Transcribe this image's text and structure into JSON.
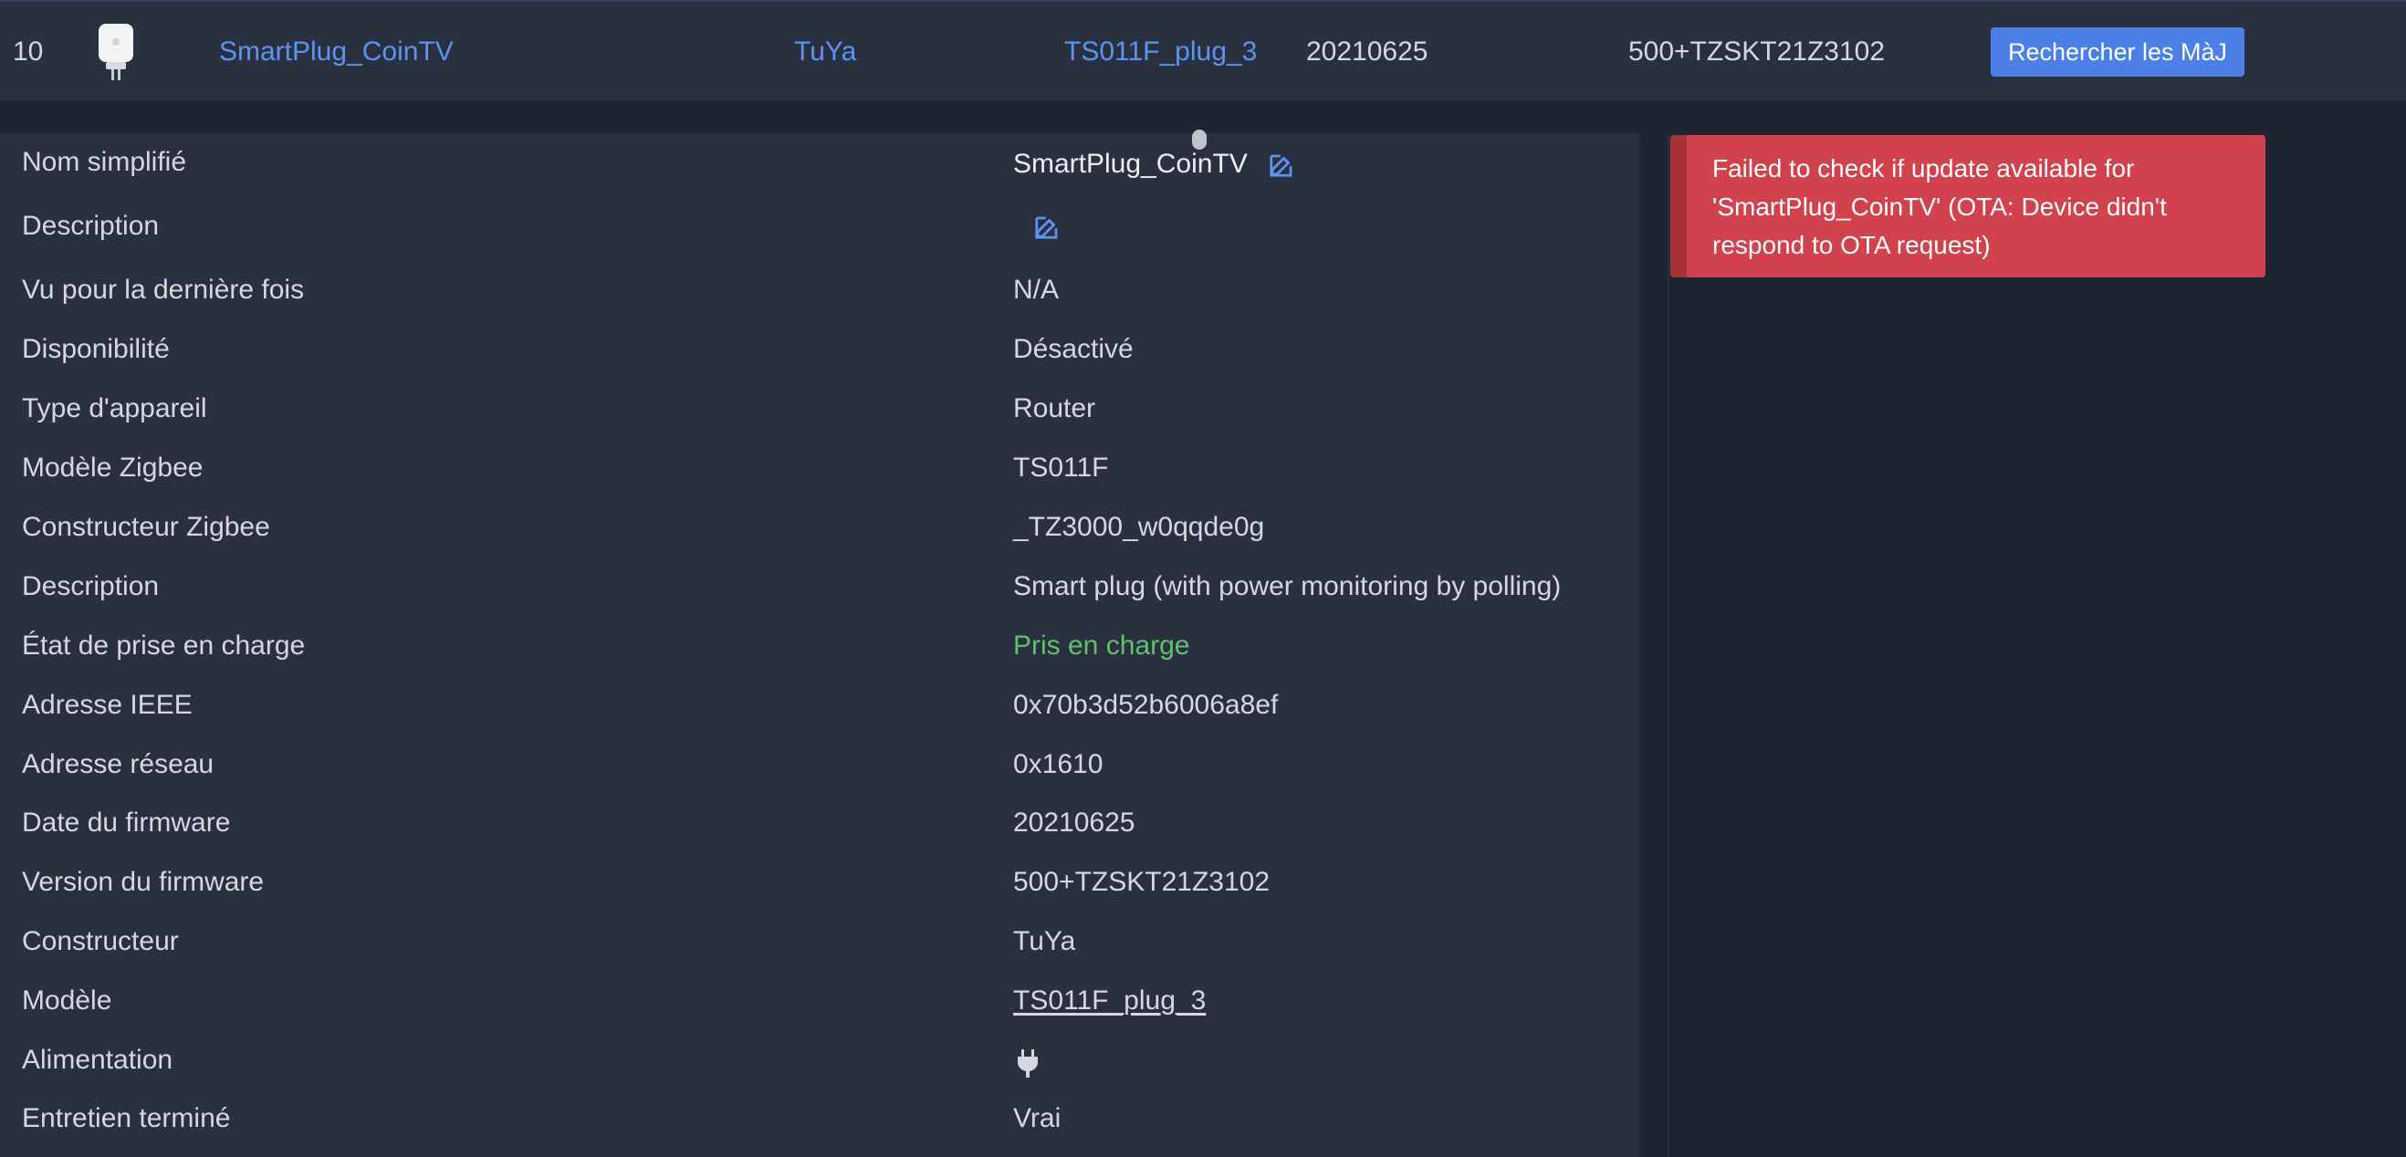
{
  "device_row": {
    "index": "10",
    "friendly_name": "SmartPlug_CoinTV",
    "vendor": "TuYa",
    "model": "TS011F_plug_3",
    "firmware_date": "20210625",
    "firmware_version": "500+TZSKT21Z3102",
    "check_update_label": "Rechercher les MàJ"
  },
  "details": [
    {
      "label": "Nom simplifié",
      "value": "SmartPlug_CoinTV"
    },
    {
      "label": "Description",
      "value": ""
    },
    {
      "label": "Vu pour la dernière fois",
      "value": "N/A"
    },
    {
      "label": "Disponibilité",
      "value": "Désactivé"
    },
    {
      "label": "Type d'appareil",
      "value": "Router"
    },
    {
      "label": "Modèle Zigbee",
      "value": "TS011F"
    },
    {
      "label": "Constructeur Zigbee",
      "value": "_TZ3000_w0qqde0g"
    },
    {
      "label": "Description",
      "value": "Smart plug (with power monitoring by polling)"
    },
    {
      "label": "État de prise en charge",
      "value": "Pris en charge"
    },
    {
      "label": "Adresse IEEE",
      "value": "0x70b3d52b6006a8ef"
    },
    {
      "label": "Adresse réseau",
      "value": "0x1610"
    },
    {
      "label": "Date du firmware",
      "value": "20210625"
    },
    {
      "label": "Version du firmware",
      "value": "500+TZSKT21Z3102"
    },
    {
      "label": "Constructeur",
      "value": "TuYa"
    },
    {
      "label": "Modèle",
      "value": "TS011F_plug_3"
    },
    {
      "label": "Alimentation",
      "value": "",
      "icon": "plug-icon"
    },
    {
      "label": "Entretien terminé",
      "value": "Vrai"
    }
  ],
  "toast": {
    "message": "Failed to check if update available for 'SmartPlug_CoinTV' (OTA: Device didn't respond to OTA request)"
  },
  "colors": {
    "accent": "#4a80e8",
    "link": "#5b95f0",
    "success": "#5fc26a",
    "error": "#d2424c"
  }
}
